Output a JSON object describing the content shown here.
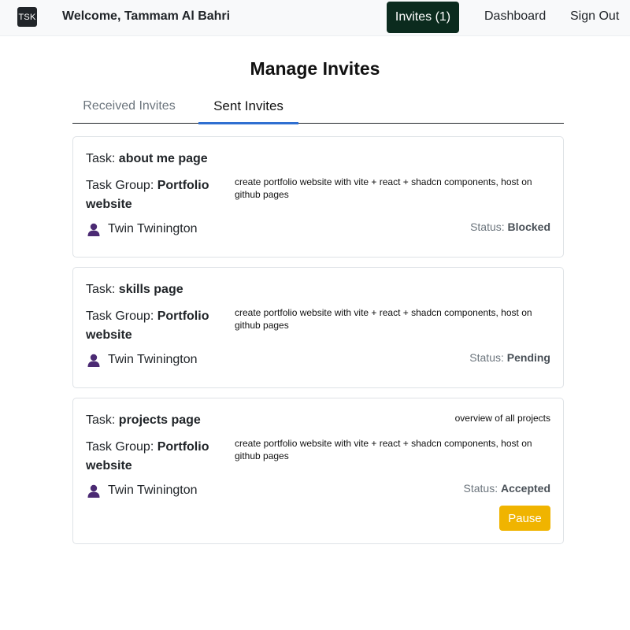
{
  "navbar": {
    "logo_text": "TSK",
    "welcome": "Welcome, Tammam Al Bahri",
    "invites_label": "Invites (1)",
    "dashboard_label": "Dashboard",
    "signout_label": "Sign Out"
  },
  "page": {
    "title": "Manage Invites"
  },
  "tabs": [
    {
      "label": "Received Invites",
      "active": false
    },
    {
      "label": "Sent Invites",
      "active": true
    }
  ],
  "labels": {
    "task_prefix": "Task: ",
    "group_prefix": "Task Group: ",
    "status_prefix": "Status: "
  },
  "invites": [
    {
      "task": "about me page",
      "task_description": "",
      "group": "Portfolio website",
      "group_description": "create portfolio website with vite + react + shadcn components, host on github pages",
      "assignee": "Twin Twinington",
      "assignee_icon": "user-icon",
      "status": "Blocked"
    },
    {
      "task": "skills page",
      "task_description": "",
      "group": "Portfolio website",
      "group_description": "create portfolio website with vite + react + shadcn components, host on github pages",
      "assignee": "Twin Twinington",
      "assignee_icon": "user-icon",
      "status": "Pending"
    },
    {
      "task": "projects page",
      "task_description": "overview of all projects",
      "group": "Portfolio website",
      "group_description": "create portfolio website with vite + react + shadcn components, host on github pages",
      "assignee": "Twin Twinington",
      "assignee_icon": "user-icon",
      "status": "Accepted",
      "action_label": "Pause"
    }
  ],
  "colors": {
    "invites_button": "#0b2b1e",
    "active_tab_underline": "#2f6fd1",
    "user_icon": "#4b2a73",
    "pause_button": "#f0b400"
  }
}
